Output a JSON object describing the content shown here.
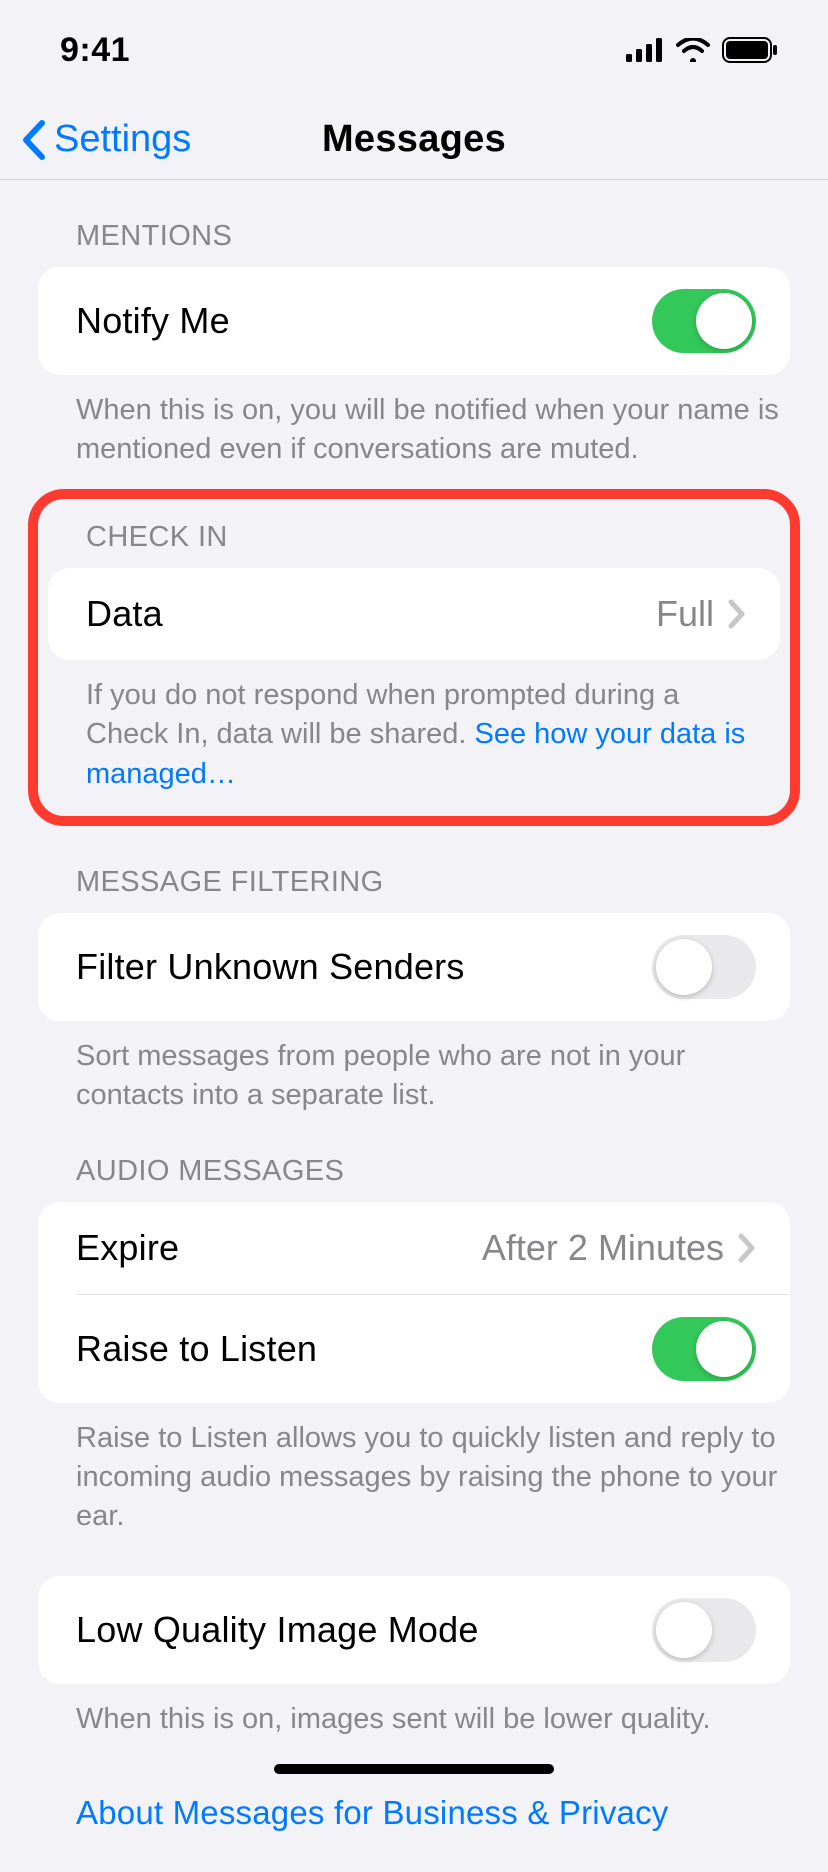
{
  "status": {
    "time": "9:41"
  },
  "nav": {
    "back": "Settings",
    "title": "Messages"
  },
  "sections": {
    "mentions": {
      "header": "MENTIONS",
      "notify": "Notify Me",
      "notify_on": true,
      "footer": "When this is on, you will be notified when your name is mentioned even if conversations are muted."
    },
    "checkin": {
      "header": "CHECK IN",
      "data_label": "Data",
      "data_value": "Full",
      "footer_text": "If you do not respond when prompted during a Check In, data will be shared. ",
      "footer_link": "See how your data is managed…"
    },
    "filtering": {
      "header": "MESSAGE FILTERING",
      "filter": "Filter Unknown Senders",
      "filter_on": false,
      "footer": "Sort messages from people who are not in your contacts into a separate list."
    },
    "audio": {
      "header": "AUDIO MESSAGES",
      "expire_label": "Expire",
      "expire_value": "After 2 Minutes",
      "raise_label": "Raise to Listen",
      "raise_on": true,
      "footer": "Raise to Listen allows you to quickly listen and reply to incoming audio messages by raising the phone to your ear."
    },
    "low_quality": {
      "label": "Low Quality Image Mode",
      "on": false,
      "footer": "When this is on, images sent will be lower quality."
    },
    "about": "About Messages for Business & Privacy"
  }
}
